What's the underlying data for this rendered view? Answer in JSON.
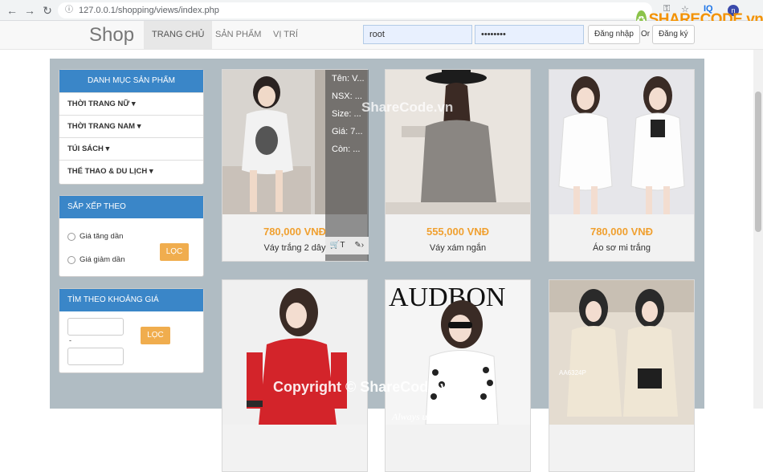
{
  "browser": {
    "url": "127.0.0.1/shopping/views/index.php",
    "back_icon": "arrow-left-icon",
    "forward_icon": "arrow-right-icon",
    "reload_icon": "reload-icon",
    "ext_iq": "IQ",
    "ext_avatar": "n"
  },
  "watermark": {
    "logo_text": "SHARECODE.vn",
    "center_text": "ShareCode.vn",
    "bottom_text": "Copyright © ShareCode.vn"
  },
  "navbar": {
    "brand": "Shop",
    "items": [
      {
        "label": "TRANG CHỦ",
        "active": true
      },
      {
        "label": "SẢN PHẨM",
        "active": false
      },
      {
        "label": "VỊ TRÍ",
        "active": false
      }
    ],
    "username_value": "root",
    "password_value": "••••••••",
    "login_label": "Đăng nhập",
    "or_label": "Or",
    "register_label": "Đăng ký"
  },
  "sidebar": {
    "categories_title": "DANH MỤC SẢN PHẨM",
    "categories": [
      "THỜI TRANG NỮ",
      "THỜI TRANG NAM",
      "TÚI SÁCH",
      "THỂ THAO & DU LỊCH"
    ],
    "sort_title": "SẮP XẾP THEO",
    "sort_options": [
      "Giá tăng dần",
      "Giá giảm dần"
    ],
    "sort_button": "LỌC",
    "price_title": "TÌM THEO KHOẢNG GIÁ",
    "price_separator": "-",
    "price_button": "LỌC"
  },
  "products": [
    {
      "price": "780,000 VNĐ",
      "name": "Váy trắng 2 dây",
      "image_colors": [
        "#d8d4cf",
        "#6b6b6b",
        "#c9c1b9"
      ]
    },
    {
      "price": "555,000 VNĐ",
      "name": "Váy xám ngắn",
      "image_colors": [
        "#e9e4de",
        "#8a8682",
        "#1c1c1c"
      ]
    },
    {
      "price": "780,000 VNĐ",
      "name": "Áo sơ mi trắng",
      "image_colors": [
        "#e6e6ea",
        "#fdfdfd",
        "#3a2b25"
      ]
    },
    {
      "price": "",
      "name": "",
      "image_colors": [
        "#f0f0f0",
        "#d3242a",
        "#3a2b25"
      ]
    },
    {
      "price": "",
      "name": "",
      "image_colors": [
        "#f5f5f5",
        "#222222",
        "#e8d6c8"
      ]
    },
    {
      "price": "",
      "name": "",
      "image_colors": [
        "#e4dcd0",
        "#efe6d4",
        "#2a2a2a"
      ]
    }
  ],
  "hover_overlay": {
    "lines": [
      "Tên: V...",
      "NSX: ...",
      "Size: ...",
      "Giá: 7...",
      "Còn: ..."
    ],
    "cart_label": "T",
    "edit_label": "›"
  },
  "image_text": {
    "magazine_title": "AUDBON",
    "magazine_caption": "Always use elegant",
    "card6_tag": "AA6324P"
  }
}
